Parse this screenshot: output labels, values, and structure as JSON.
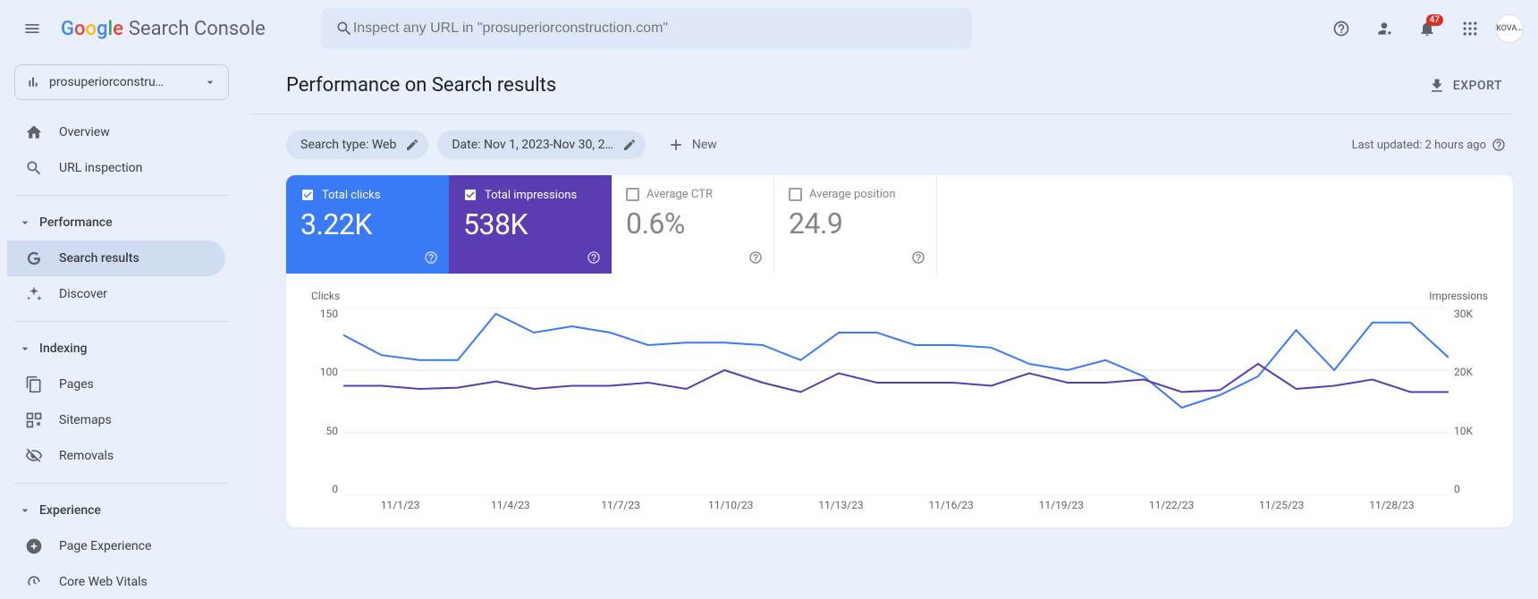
{
  "header": {
    "product_name": "Search Console",
    "search_placeholder": "Inspect any URL in \"prosuperiorconstruction.com\"",
    "notification_count": "47",
    "avatar_initials": "KOVA…"
  },
  "sidebar": {
    "property": "prosuperiorconstru…",
    "items": {
      "overview": "Overview",
      "url_inspection": "URL inspection",
      "performance_section": "Performance",
      "search_results": "Search results",
      "discover": "Discover",
      "indexing_section": "Indexing",
      "pages": "Pages",
      "sitemaps": "Sitemaps",
      "removals": "Removals",
      "experience_section": "Experience",
      "page_experience": "Page Experience",
      "core_web_vitals": "Core Web Vitals"
    }
  },
  "page": {
    "title": "Performance on Search results",
    "export": "EXPORT",
    "filter_search_type": "Search type: Web",
    "filter_date": "Date: Nov 1, 2023-Nov 30, 2…",
    "new": "New",
    "last_updated": "Last updated: 2 hours ago"
  },
  "metrics": {
    "clicks_label": "Total clicks",
    "clicks_value": "3.22K",
    "impressions_label": "Total impressions",
    "impressions_value": "538K",
    "ctr_label": "Average CTR",
    "ctr_value": "0.6%",
    "position_label": "Average position",
    "position_value": "24.9"
  },
  "chart_data": {
    "type": "line",
    "title": "",
    "left_axis_label": "Clicks",
    "right_axis_label": "Impressions",
    "y_left_ticks": [
      "150",
      "100",
      "50",
      "0"
    ],
    "y_right_ticks": [
      "30K",
      "20K",
      "10K",
      "0"
    ],
    "x_ticks": [
      "11/1/23",
      "11/4/23",
      "11/7/23",
      "11/10/23",
      "11/13/23",
      "11/16/23",
      "11/19/23",
      "11/22/23",
      "11/25/23",
      "11/28/23"
    ],
    "x": [
      "11/1",
      "11/2",
      "11/3",
      "11/4",
      "11/5",
      "11/6",
      "11/7",
      "11/8",
      "11/9",
      "11/10",
      "11/11",
      "11/12",
      "11/13",
      "11/14",
      "11/15",
      "11/16",
      "11/17",
      "11/18",
      "11/19",
      "11/20",
      "11/21",
      "11/22",
      "11/23",
      "11/24",
      "11/25",
      "11/26",
      "11/27",
      "11/28",
      "11/29",
      "11/30"
    ],
    "series": [
      {
        "name": "Clicks",
        "axis": "left",
        "color": "#3a7af5",
        "values": [
          128,
          112,
          108,
          108,
          145,
          130,
          135,
          130,
          120,
          122,
          122,
          120,
          108,
          130,
          130,
          120,
          120,
          118,
          105,
          100,
          108,
          95,
          70,
          80,
          95,
          132,
          100,
          138,
          138,
          110
        ]
      },
      {
        "name": "Impressions",
        "axis": "right",
        "color": "#5a3db0",
        "values": [
          17500,
          17500,
          17000,
          17200,
          18200,
          17000,
          17500,
          17500,
          18000,
          17000,
          20000,
          18000,
          16500,
          19500,
          18000,
          18000,
          18000,
          17500,
          19500,
          18000,
          18000,
          18500,
          16500,
          16800,
          21000,
          17000,
          17500,
          18500,
          16500,
          16500
        ]
      }
    ],
    "ylim_left": [
      0,
      150
    ],
    "ylim_right": [
      0,
      30000
    ]
  }
}
